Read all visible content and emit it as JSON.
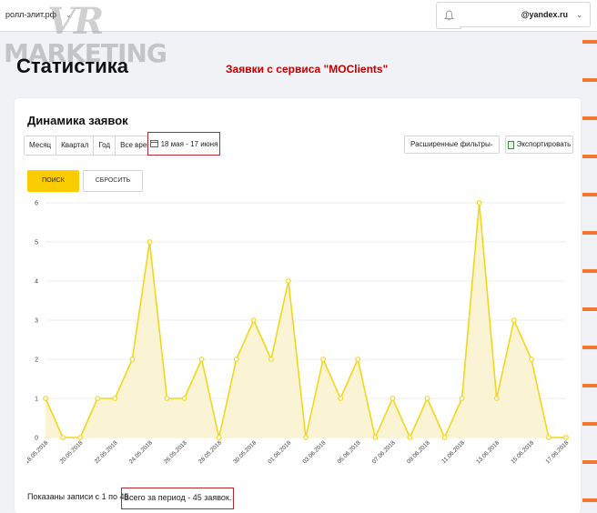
{
  "topbar": {
    "site": "ролл-элит.рф",
    "user_email": "@yandex.ru"
  },
  "logo": {
    "line1": "VR",
    "line2": "MARKETING"
  },
  "page_title": "Статистика",
  "banner": "Заявки с сервиса \"MOClients\"",
  "card": {
    "title": "Динамика заявок",
    "periods": [
      "Месяц",
      "Квартал",
      "Год",
      "Все время"
    ],
    "date_range": "18 мая - 17 июня",
    "filters_label": "Расширенные фильтры",
    "export_label": "Экспортировать",
    "search_label": "ПОИСК",
    "reset_label": "СБРОСИТЬ",
    "footer_shown": "Показаны записи с 1 по 45.",
    "footer_total": "Всего за период - 45 заявок."
  },
  "colors": {
    "accent": "#fbcc00",
    "line": "#f2d61c",
    "fill": "#fbf4d4",
    "highlight": "#b02a30",
    "banner": "#c00000"
  },
  "chart_data": {
    "type": "area",
    "x": [
      "18.05.2018",
      "19.05.2018",
      "20.05.2018",
      "21.05.2018",
      "22.05.2018",
      "23.05.2018",
      "24.05.2018",
      "25.05.2018",
      "26.05.2018",
      "27.05.2018",
      "28.05.2018",
      "29.05.2018",
      "30.05.2018",
      "31.05.2018",
      "01.06.2018",
      "02.06.2018",
      "03.06.2018",
      "04.06.2018",
      "05.06.2018",
      "06.06.2018",
      "07.06.2018",
      "08.06.2018",
      "09.06.2018",
      "10.06.2018",
      "11.06.2018",
      "12.06.2018",
      "13.06.2018",
      "14.06.2018",
      "15.06.2018",
      "16.06.2018",
      "17.06.2018"
    ],
    "x_tick_labels": [
      "18.05.2018",
      "20.05.2018",
      "22.05.2018",
      "24.05.2018",
      "26.05.2018",
      "28.05.2018",
      "30.05.2018",
      "01.06.2018",
      "03.06.2018",
      "05.06.2018",
      "07.06.2018",
      "09.06.2018",
      "11.06.2018",
      "13.06.2018",
      "15.06.2018",
      "17.06.2018"
    ],
    "values": [
      1,
      0,
      0,
      1,
      1,
      2,
      5,
      1,
      1,
      2,
      0,
      2,
      3,
      2,
      4,
      0,
      2,
      1,
      2,
      0,
      1,
      0,
      1,
      0,
      1,
      6,
      1,
      3,
      2,
      0,
      0
    ],
    "ylim": [
      0,
      6
    ],
    "yticks": [
      0,
      1,
      2,
      3,
      4,
      5,
      6
    ],
    "grid": true,
    "title": "",
    "xlabel": "",
    "ylabel": ""
  }
}
